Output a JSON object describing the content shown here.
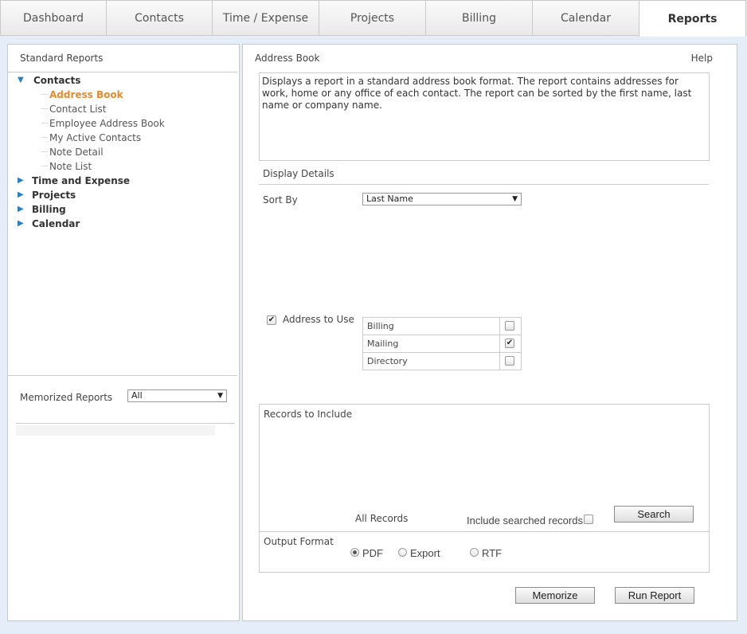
{
  "tabs": [
    {
      "label": "Dashboard",
      "active": false
    },
    {
      "label": "Contacts",
      "active": false
    },
    {
      "label": "Time / Expense",
      "active": false
    },
    {
      "label": "Projects",
      "active": false
    },
    {
      "label": "Billing",
      "active": false
    },
    {
      "label": "Calendar",
      "active": false
    },
    {
      "label": "Reports",
      "active": true
    }
  ],
  "left_panel": {
    "header": "Standard Reports",
    "tree": {
      "contacts": {
        "label": "Contacts",
        "items": [
          "Address Book",
          "Contact List",
          "Employee Address Book",
          "My Active Contacts",
          "Note Detail",
          "Note List"
        ],
        "selected": "Address Book"
      },
      "categories": [
        "Time and Expense",
        "Projects",
        "Billing",
        "Calendar"
      ]
    },
    "memorized": {
      "label": "Memorized Reports",
      "filter_value": "All"
    }
  },
  "report": {
    "title": "Address Book",
    "help_label": "Help",
    "description": "Displays a report in a standard address book format. The report contains addresses for work, home or any office of each contact. The report can be sorted by the first name, last name or company name.",
    "display_details_label": "Display Details",
    "sort_by_label": "Sort By",
    "sort_by_value": "Last Name",
    "address_to_use": {
      "label": "Address to Use",
      "checked": true,
      "options": [
        {
          "label": "Billing",
          "checked": false
        },
        {
          "label": "Mailing",
          "checked": true
        },
        {
          "label": "Directory",
          "checked": false
        }
      ]
    },
    "records": {
      "label": "Records to Include",
      "all_records_label": "All Records",
      "include_searched_label": "Include searched records",
      "include_searched_checked": false,
      "search_button": "Search"
    },
    "output_format": {
      "label": "Output Format",
      "options": [
        {
          "label": "PDF",
          "selected": true
        },
        {
          "label": "Export",
          "selected": false
        },
        {
          "label": "RTF",
          "selected": false
        }
      ]
    },
    "memorize_button": "Memorize",
    "run_button": "Run Report"
  }
}
